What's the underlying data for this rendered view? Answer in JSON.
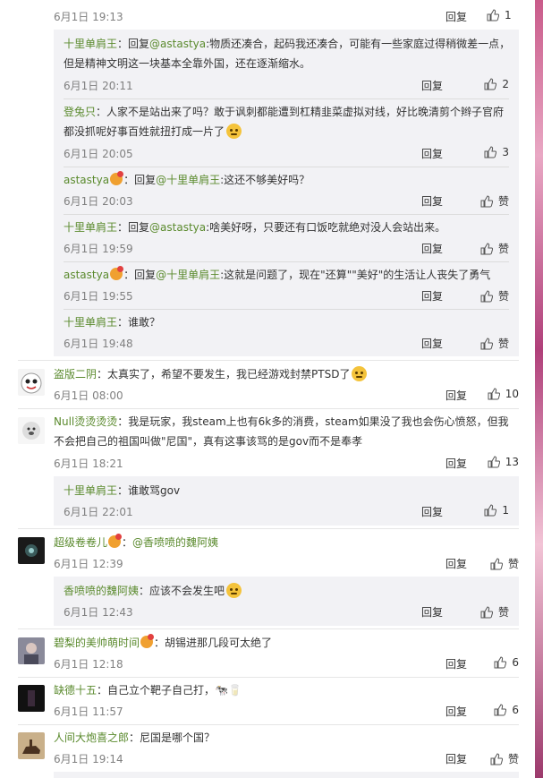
{
  "strings": {
    "reply": "回复",
    "zan": "赞",
    "sep": "：",
    "reply_to": "回复",
    "at": "@"
  },
  "top_partial": {
    "time": "6月1日 19:13",
    "likes": "1"
  },
  "sub1": [
    {
      "user": "十里单肩王",
      "reply_to": "@astastya",
      "text": ":物质还凑合，起码我还凑合，可能有一些家庭过得稍微差一点，但是精神文明这一块基本全靠外国，还在逐渐缩水。",
      "time": "6月1日 20:11",
      "likes": "2"
    },
    {
      "user": "登兔只",
      "text": "人家不是站出来了吗？敢于讽刺都能遭到杠精韭菜虚拟对线，好比晚清剪个辫子官府都没抓呢好事百姓就扭打成一片了",
      "time": "6月1日 20:05",
      "likes": "3"
    },
    {
      "user": "astastya",
      "reply_to": "@十里单肩王",
      "text": ":这还不够美好吗？",
      "time": "6月1日 20:03",
      "likes": "赞"
    },
    {
      "user": "十里单肩王",
      "reply_to": "@astastya",
      "text": ":啥美好呀，只要还有口饭吃就绝对没人会站出来。",
      "time": "6月1日 19:59",
      "likes": "赞"
    },
    {
      "user": "astastya",
      "reply_to": "@十里单肩王",
      "text": ":这就是问题了，现在\"还算\"\"美好\"的生活让人丧失了勇气",
      "time": "6月1日 19:55",
      "likes": "赞"
    },
    {
      "user": "十里单肩王",
      "text": "谁敢？",
      "time": "6月1日 19:48",
      "likes": "赞"
    }
  ],
  "c1": {
    "user": "盗版二阴",
    "text": "太真实了，希望不要发生，我已经游戏封禁PTSD了",
    "time": "6月1日 08:00",
    "likes": "10"
  },
  "c2": {
    "user": "Null烫烫烫烫",
    "text": "我是玩家，我steam上也有6k多的消费，steam如果没了我也会伤心愤怒，但我不会把自己的祖国叫做\"尼国\"，真有这事该骂的是gov而不是奉孝",
    "time": "6月1日 18:21",
    "likes": "13"
  },
  "c2sub": {
    "user": "十里单肩王",
    "text": "谁敢骂gov",
    "time": "6月1日 22:01",
    "likes": "1"
  },
  "c3": {
    "user": "超级卷卷儿",
    "text": "@香喷喷的魏阿姨",
    "time": "6月1日 12:39",
    "likes": "赞"
  },
  "c3sub": {
    "user": "香喷喷的魏阿姨",
    "text": "应该不会发生吧",
    "time": "6月1日 12:43",
    "likes": "赞"
  },
  "c4": {
    "user": "碧梨的美帅萌时间",
    "text": "胡锡进那几段可太绝了",
    "time": "6月1日 12:18",
    "likes": "6"
  },
  "c5": {
    "user": "缺德十五",
    "text": "自己立个靶子自己打，",
    "time": "6月1日 11:57",
    "likes": "6"
  },
  "c6": {
    "user": "人间大炮喜之郎",
    "text": "尼国是哪个国？",
    "time": "6月1日 19:14",
    "likes": "赞"
  },
  "colors": {
    "username": "#5a8a2d",
    "meta": "#808080",
    "subbg": "#f2f2f5"
  }
}
